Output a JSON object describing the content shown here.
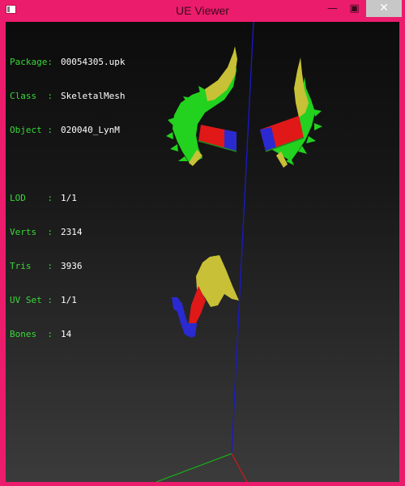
{
  "window": {
    "title": "UE Viewer",
    "buttons": {
      "minimize": "—",
      "maximize": "▣",
      "close": "✕"
    }
  },
  "info": {
    "package_label": "Package:",
    "package_value": "00054305.upk",
    "class_label": "Class  :",
    "class_value": "SkeletalMesh",
    "object_label": "Object :",
    "object_value": "020040_LynM",
    "lod_label": "LOD    :",
    "lod_value": "1/1",
    "verts_label": "Verts  :",
    "verts_value": "2314",
    "tris_label": "Tris   :",
    "tris_value": "3936",
    "uvset_label": "UV Set :",
    "uvset_value": "1/1",
    "bones_label": "Bones  :",
    "bones_value": "14"
  },
  "colors": {
    "window_frame": "#ec1c6c",
    "label_green": "#38d838",
    "value_white": "#ffffff",
    "mesh_green": "#22d21e",
    "mesh_yellow": "#c8c036",
    "mesh_red": "#e01818",
    "mesh_blue": "#2a2ad0",
    "axis_blue": "#1a1ac8",
    "axis_green": "#1aa81a",
    "axis_red": "#c81a1a"
  }
}
